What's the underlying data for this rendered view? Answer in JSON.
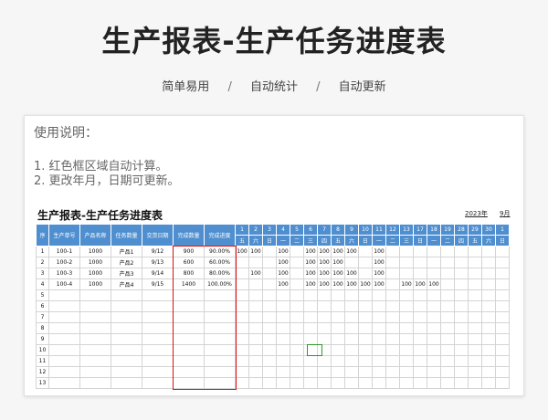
{
  "page_title": "生产报表-生产任务进度表",
  "subtitles": [
    "简单易用",
    "自动统计",
    "自动更新"
  ],
  "separator": "/",
  "instructions": {
    "heading": "使用说明：",
    "lines": [
      "1. 红色框区域自动计算。",
      "2. 更改年月，日期可更新。"
    ]
  },
  "sheet": {
    "title": "生产报表-生产任务进度表",
    "year": "2023年",
    "month": "9月",
    "headers": [
      "序",
      "生产单号",
      "产品名称",
      "任务数量",
      "交货日期",
      "完成数量",
      "完成进度"
    ],
    "days": [
      "1",
      "2",
      "3",
      "4",
      "5",
      "6",
      "7",
      "8",
      "9",
      "10",
      "11",
      "12",
      "13",
      "17",
      "18",
      "19",
      "28",
      "29",
      "30",
      "1"
    ],
    "weekdays": [
      "五",
      "六",
      "日",
      "一",
      "二",
      "三",
      "四",
      "五",
      "六",
      "日",
      "一",
      "二",
      "三",
      "日",
      "一",
      "二",
      "四",
      "五",
      "六",
      "日"
    ],
    "rows": [
      {
        "no": "1",
        "order": "100-1",
        "qty": "1000",
        "product": "产品1",
        "date": "9/12",
        "done": "900",
        "progress": "90.00%",
        "days": [
          "100",
          "100",
          "",
          "100",
          "",
          "100",
          "100",
          "100",
          "100",
          "",
          "100",
          "",
          "",
          "",
          "",
          "",
          "",
          "",
          "",
          ""
        ]
      },
      {
        "no": "2",
        "order": "100-2",
        "qty": "1000",
        "product": "产品2",
        "date": "9/13",
        "done": "600",
        "progress": "60.00%",
        "days": [
          "",
          "",
          "",
          "100",
          "",
          "100",
          "100",
          "100",
          "",
          "",
          "100",
          "",
          "",
          "",
          "",
          "",
          "",
          "",
          "",
          ""
        ]
      },
      {
        "no": "3",
        "order": "100-3",
        "qty": "1000",
        "product": "产品3",
        "date": "9/14",
        "done": "800",
        "progress": "80.00%",
        "days": [
          "",
          "100",
          "",
          "100",
          "",
          "100",
          "100",
          "100",
          "100",
          "",
          "100",
          "",
          "",
          "",
          "",
          "",
          "",
          "",
          "",
          ""
        ]
      },
      {
        "no": "4",
        "order": "100-4",
        "qty": "1000",
        "product": "产品4",
        "date": "9/15",
        "done": "1400",
        "progress": "100.00%",
        "days": [
          "",
          "",
          "",
          "100",
          "",
          "100",
          "100",
          "100",
          "100",
          "100",
          "100",
          "",
          "100",
          "100",
          "100",
          "",
          "",
          "",
          "",
          ""
        ]
      },
      {
        "no": "5",
        "order": "",
        "qty": "",
        "product": "",
        "date": "",
        "done": "",
        "progress": "",
        "days": []
      },
      {
        "no": "6",
        "order": "",
        "qty": "",
        "product": "",
        "date": "",
        "done": "",
        "progress": "",
        "days": []
      },
      {
        "no": "7",
        "order": "",
        "qty": "",
        "product": "",
        "date": "",
        "done": "",
        "progress": "",
        "days": []
      },
      {
        "no": "8",
        "order": "",
        "qty": "",
        "product": "",
        "date": "",
        "done": "",
        "progress": "",
        "days": []
      },
      {
        "no": "9",
        "order": "",
        "qty": "",
        "product": "",
        "date": "",
        "done": "",
        "progress": "",
        "days": []
      },
      {
        "no": "10",
        "order": "",
        "qty": "",
        "product": "",
        "date": "",
        "done": "",
        "progress": "",
        "days": []
      },
      {
        "no": "11",
        "order": "",
        "qty": "",
        "product": "",
        "date": "",
        "done": "",
        "progress": "",
        "days": []
      },
      {
        "no": "12",
        "order": "",
        "qty": "",
        "product": "",
        "date": "",
        "done": "",
        "progress": "",
        "days": []
      },
      {
        "no": "13",
        "order": "",
        "qty": "",
        "product": "",
        "date": "",
        "done": "",
        "progress": "",
        "days": []
      }
    ]
  },
  "colors": {
    "header_blue": "#4f8fcf",
    "calc_area_red": "#dd1111",
    "selection_green": "#2a9a2a"
  }
}
